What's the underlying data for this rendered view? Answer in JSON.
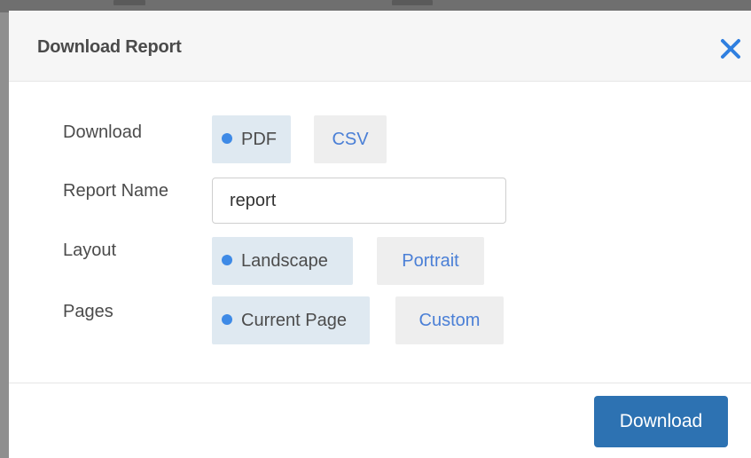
{
  "dialog": {
    "title": "Download Report",
    "close_icon": "close-icon"
  },
  "form": {
    "download": {
      "label": "Download",
      "options": [
        "PDF",
        "CSV"
      ],
      "selected": "PDF"
    },
    "report_name": {
      "label": "Report Name",
      "value": "report"
    },
    "layout": {
      "label": "Layout",
      "options": [
        "Landscape",
        "Portrait"
      ],
      "selected": "Landscape"
    },
    "pages": {
      "label": "Pages",
      "options": [
        "Current Page",
        "Custom"
      ],
      "selected": "Current Page"
    }
  },
  "footer": {
    "download_button_label": "Download"
  },
  "colors": {
    "accent": "#3e8ae6",
    "link": "#4a7fd6",
    "primary_button": "#2d72b2",
    "selected_option_bg": "#dfe9f1",
    "unselected_option_bg": "#eeeeee"
  }
}
